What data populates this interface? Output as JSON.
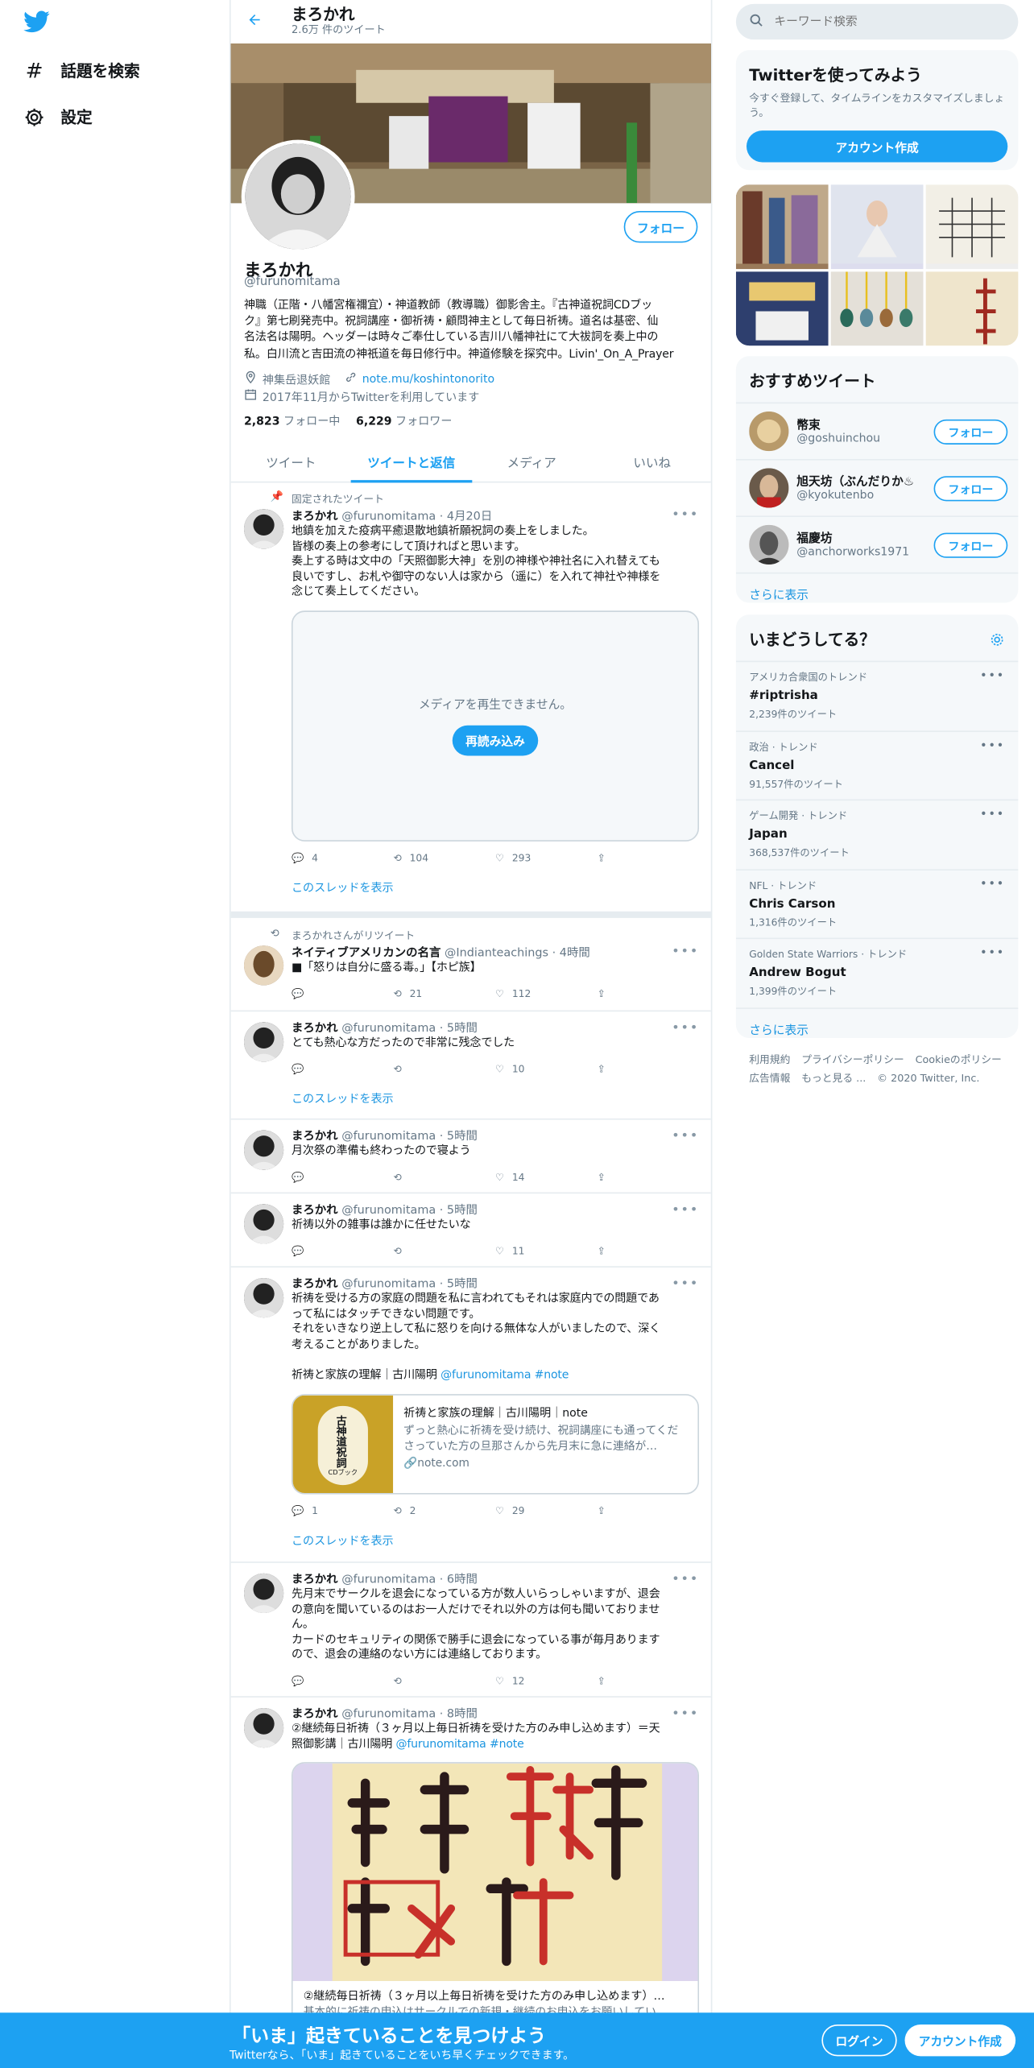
{
  "nav": {
    "explore_label": "話題を検索",
    "settings_label": "設定"
  },
  "header": {
    "name": "まろかれ",
    "tweet_count": "2.6万 件のツイート"
  },
  "profile": {
    "name": "まろかれ",
    "handle": "@furunomitama",
    "follow_label": "フォロー",
    "bio_lines": [
      "神職（正階・八幡宮権禰宜）・神道教師（教導職）御影舎主。『古神道祝詞CDブッ",
      "ク』第七刷発売中。祝詞講座・御祈祷・顧問神主として毎日祈祷。道名は基密、仙",
      "名法名は陽明。ヘッダーは時々ご奉仕している吉川八幡神社にて大祓詞を奏上中の",
      "私。白川流と吉田流の神祇道を毎日修行中。神道修験を探究中。Livin'_On_A_Prayer"
    ],
    "location": "神集岳退妖館",
    "url": "note.mu/koshintonorito",
    "joined": "2017年11月からTwitterを利用しています",
    "following_count": "2,823",
    "following_label": "フォロー中",
    "followers_count": "6,229",
    "followers_label": "フォロワー"
  },
  "tabs": [
    "ツイート",
    "ツイートと返信",
    "メディア",
    "いいね"
  ],
  "tweets": [
    {
      "context": "固定されたツイート",
      "name": "まろかれ",
      "handle": "@furunomitama",
      "time": "· 4月20日",
      "lines": [
        "地鎮を加えた疫病平癒退散地鎮祈願祝詞の奏上をしました。",
        "皆様の奏上の参考にして頂ければと思います。",
        "奏上する時は文中の「天照御影大神」を別の神様や神社名に入れ替えても",
        "良いですし、お札や御守のない人は家から（遥に）を入れて神社や神様を",
        "念じて奏上してください。"
      ],
      "media_error": "メディアを再生できません。",
      "reload_label": "再読み込み",
      "replies": "4",
      "retweets": "104",
      "likes": "293",
      "thread_label": "このスレッドを表示"
    },
    {
      "context": "まろかれさんがリツイート",
      "name": "ネイティブアメリカンの名言",
      "handle": "@Indianteachings",
      "time": "· 4時間",
      "lines": [
        "■「怒りは自分に盛る毒。」【ホピ族】"
      ],
      "replies": "",
      "retweets": "21",
      "likes": "112"
    },
    {
      "name": "まろかれ",
      "handle": "@furunomitama",
      "time": "· 5時間",
      "lines": [
        "とても熱心な方だったので非常に残念でした"
      ],
      "replies": "",
      "retweets": "",
      "likes": "10",
      "thread_label": "このスレッドを表示"
    },
    {
      "name": "まろかれ",
      "handle": "@furunomitama",
      "time": "· 5時間",
      "lines": [
        "月次祭の準備も終わったので寝よう"
      ],
      "replies": "",
      "retweets": "",
      "likes": "14"
    },
    {
      "name": "まろかれ",
      "handle": "@furunomitama",
      "time": "· 5時間",
      "lines": [
        "祈祷以外の雑事は誰かに任せたいな"
      ],
      "replies": "",
      "retweets": "",
      "likes": "11"
    },
    {
      "name": "まろかれ",
      "handle": "@furunomitama",
      "time": "· 5時間",
      "lines": [
        "祈祷を受ける方の家庭の問題を私に言われてもそれは家庭内での問題であ",
        "って私にはタッチできない問題です。",
        "それをいきなり逆上して私に怒りを向ける無体な人がいましたので、深く",
        "考えることがありました。",
        "",
        "祈祷と家族の理解｜古川陽明 "
      ],
      "link_mention": "@furunomitama #note",
      "card_title": "祈祷と家族の理解｜古川陽明｜note",
      "card_desc": "ずっと熱心に祈祷を受け続け、祝詞講座にも通ってくださっていた方の旦那さんから先月末に急に連絡が…",
      "card_domain": "note.com",
      "card_cover": "古神道祝詞",
      "card_cover_sub": "CDブック",
      "replies": "1",
      "retweets": "2",
      "likes": "29",
      "thread_label": "このスレッドを表示"
    },
    {
      "name": "まろかれ",
      "handle": "@furunomitama",
      "time": "· 6時間",
      "lines": [
        "先月末でサークルを退会になっている方が数人いらっしゃいますが、退会",
        "の意向を聞いているのはお一人だけでそれ以外の方は何も聞いておりませ",
        "ん。",
        "カードのセキュリティの関係で勝手に退会になっている事が毎月あります",
        "ので、退会の連絡のない方には連絡しております。"
      ],
      "replies": "",
      "retweets": "",
      "likes": "12"
    },
    {
      "name": "まろかれ",
      "handle": "@furunomitama",
      "time": "· 8時間",
      "lines": [
        "②継続毎日祈祷（３ヶ月以上毎日祈祷を受けた方のみ申し込めます）＝天",
        "照御影講｜古川陽明 "
      ],
      "link_mention": "@furunomitama #note",
      "card_title": "②継続毎日祈祷（３ヶ月以上毎日祈祷を受けた方のみ申し込めます）…",
      "card_desc": "基本的に祈祷の申込はサークルでの新規・継続のお申込をお願いしてい…"
    }
  ],
  "search": {
    "placeholder": "キーワード検索"
  },
  "signup_box": {
    "title": "Twitterを使ってみよう",
    "desc": "今すぐ登録して、タイムラインをカスタマイズしましょう。",
    "button": "アカウント作成"
  },
  "recommended": {
    "title": "おすすめツイート",
    "items": [
      {
        "name": "幣束",
        "handle": "@goshuinchou",
        "follow": "フォロー"
      },
      {
        "name": "旭天坊（ぶんだりか♨",
        "handle": "@kyokutenbo",
        "follow": "フォロー"
      },
      {
        "name": "福慶坊",
        "handle": "@anchorworks1971",
        "follow": "フォロー"
      }
    ],
    "more": "さらに表示"
  },
  "trends": {
    "title": "いまどうしてる？",
    "items": [
      {
        "context": "アメリカ合衆国のトレンド",
        "name": "#riptrisha",
        "count": "2,239件のツイート"
      },
      {
        "context": "政治 · トレンド",
        "name": "Cancel",
        "count": "91,557件のツイート"
      },
      {
        "context": "ゲーム開発 · トレンド",
        "name": "Japan",
        "count": "368,537件のツイート"
      },
      {
        "context": "NFL · トレンド",
        "name": "Chris Carson",
        "count": "1,316件のツイート"
      },
      {
        "context": "Golden State Warriors · トレンド",
        "name": "Andrew Bogut",
        "count": "1,399件のツイート"
      }
    ],
    "more": "さらに表示"
  },
  "footer": {
    "terms": "利用規約",
    "privacy": "プライバシーポリシー",
    "cookie": "Cookieのポリシー",
    "ads": "広告情報",
    "more": "もっと見る ...",
    "copyright": "© 2020 Twitter, Inc."
  },
  "bottombar": {
    "title": "「いま」起きていることを見つけよう",
    "subtitle": "Twitterなら、「いま」起きていることをいち早くチェックできます。",
    "login": "ログイン",
    "signup": "アカウント作成"
  },
  "colors": {
    "accent": "#1da1f2",
    "link": "#1b95e0",
    "muted": "#657786",
    "border": "#e6ecf0",
    "panel": "#f5f8fa"
  }
}
